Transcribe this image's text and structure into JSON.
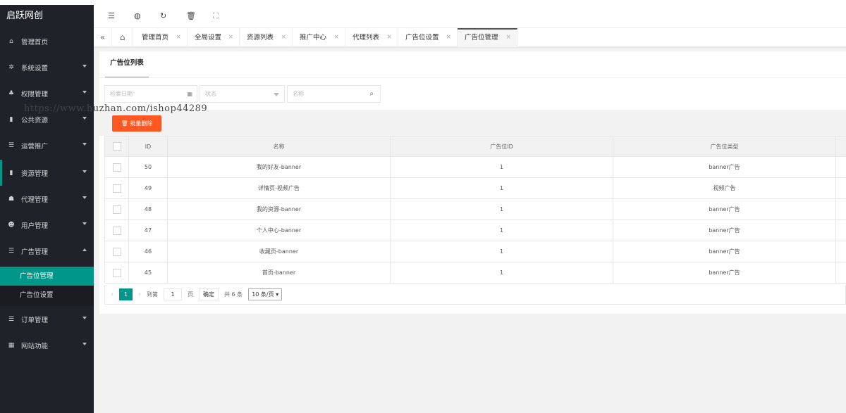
{
  "app": {
    "title": "启跃网创",
    "watermark": "https://www.huzhan.com/ishop44289"
  },
  "sidebar": {
    "items": [
      {
        "label": "管理首页",
        "icon": "home-icon",
        "glyph": "⌂"
      },
      {
        "label": "系统设置",
        "icon": "gear-icon",
        "glyph": "✲"
      },
      {
        "label": "权限管理",
        "icon": "users-icon",
        "glyph": "♣"
      },
      {
        "label": "公共资源",
        "icon": "book-icon",
        "glyph": "▮"
      },
      {
        "label": "运营推广",
        "icon": "list-icon",
        "glyph": "☰"
      },
      {
        "label": "资源管理",
        "icon": "book-icon",
        "glyph": "▮"
      },
      {
        "label": "代理管理",
        "icon": "user-group-icon",
        "glyph": "☗"
      },
      {
        "label": "用户管理",
        "icon": "user-icon",
        "glyph": "☻"
      },
      {
        "label": "广告管理",
        "icon": "list-icon",
        "glyph": "☰"
      },
      {
        "label": "订单管理",
        "icon": "list-icon",
        "glyph": "☰"
      },
      {
        "label": "网站功能",
        "icon": "grid-icon",
        "glyph": "▦"
      }
    ],
    "sub_items": [
      {
        "label": "广告位管理"
      },
      {
        "label": "广告位设置"
      }
    ]
  },
  "tabs": [
    {
      "label": "管理首页"
    },
    {
      "label": "全局设置"
    },
    {
      "label": "资源列表"
    },
    {
      "label": "推广中心"
    },
    {
      "label": "代理列表"
    },
    {
      "label": "广告位设置"
    },
    {
      "label": "广告位管理"
    }
  ],
  "card": {
    "tab_label": "广告位列表",
    "filters": {
      "date_placeholder": "检索日期",
      "status_placeholder": "状态",
      "name_placeholder": "名称"
    },
    "batch_delete_label": "批量删除",
    "table": {
      "columns": [
        "ID",
        "名称",
        "广告位ID",
        "广告位类型"
      ],
      "rows": [
        {
          "id": "50",
          "name": "我的好友-banner",
          "position_id": "1",
          "type": "banner广告"
        },
        {
          "id": "49",
          "name": "详情页-视频广告",
          "position_id": "1",
          "type": "视频广告"
        },
        {
          "id": "48",
          "name": "我的资源-banner",
          "position_id": "1",
          "type": "banner广告"
        },
        {
          "id": "47",
          "name": "个人中心-banner",
          "position_id": "1",
          "type": "banner广告"
        },
        {
          "id": "46",
          "name": "收藏页-banner",
          "position_id": "1",
          "type": "banner广告"
        },
        {
          "id": "45",
          "name": "首页-banner",
          "position_id": "1",
          "type": "banner广告"
        }
      ]
    },
    "pager": {
      "current": "1",
      "goto_label": "到第",
      "goto_value": "1",
      "page_unit": "页",
      "confirm_label": "确定",
      "total_label": "共 6 条",
      "page_size": "10 条/页"
    }
  },
  "colors": {
    "accent": "#009688",
    "danger": "#ff5722",
    "sidebar_bg": "#20222a"
  }
}
